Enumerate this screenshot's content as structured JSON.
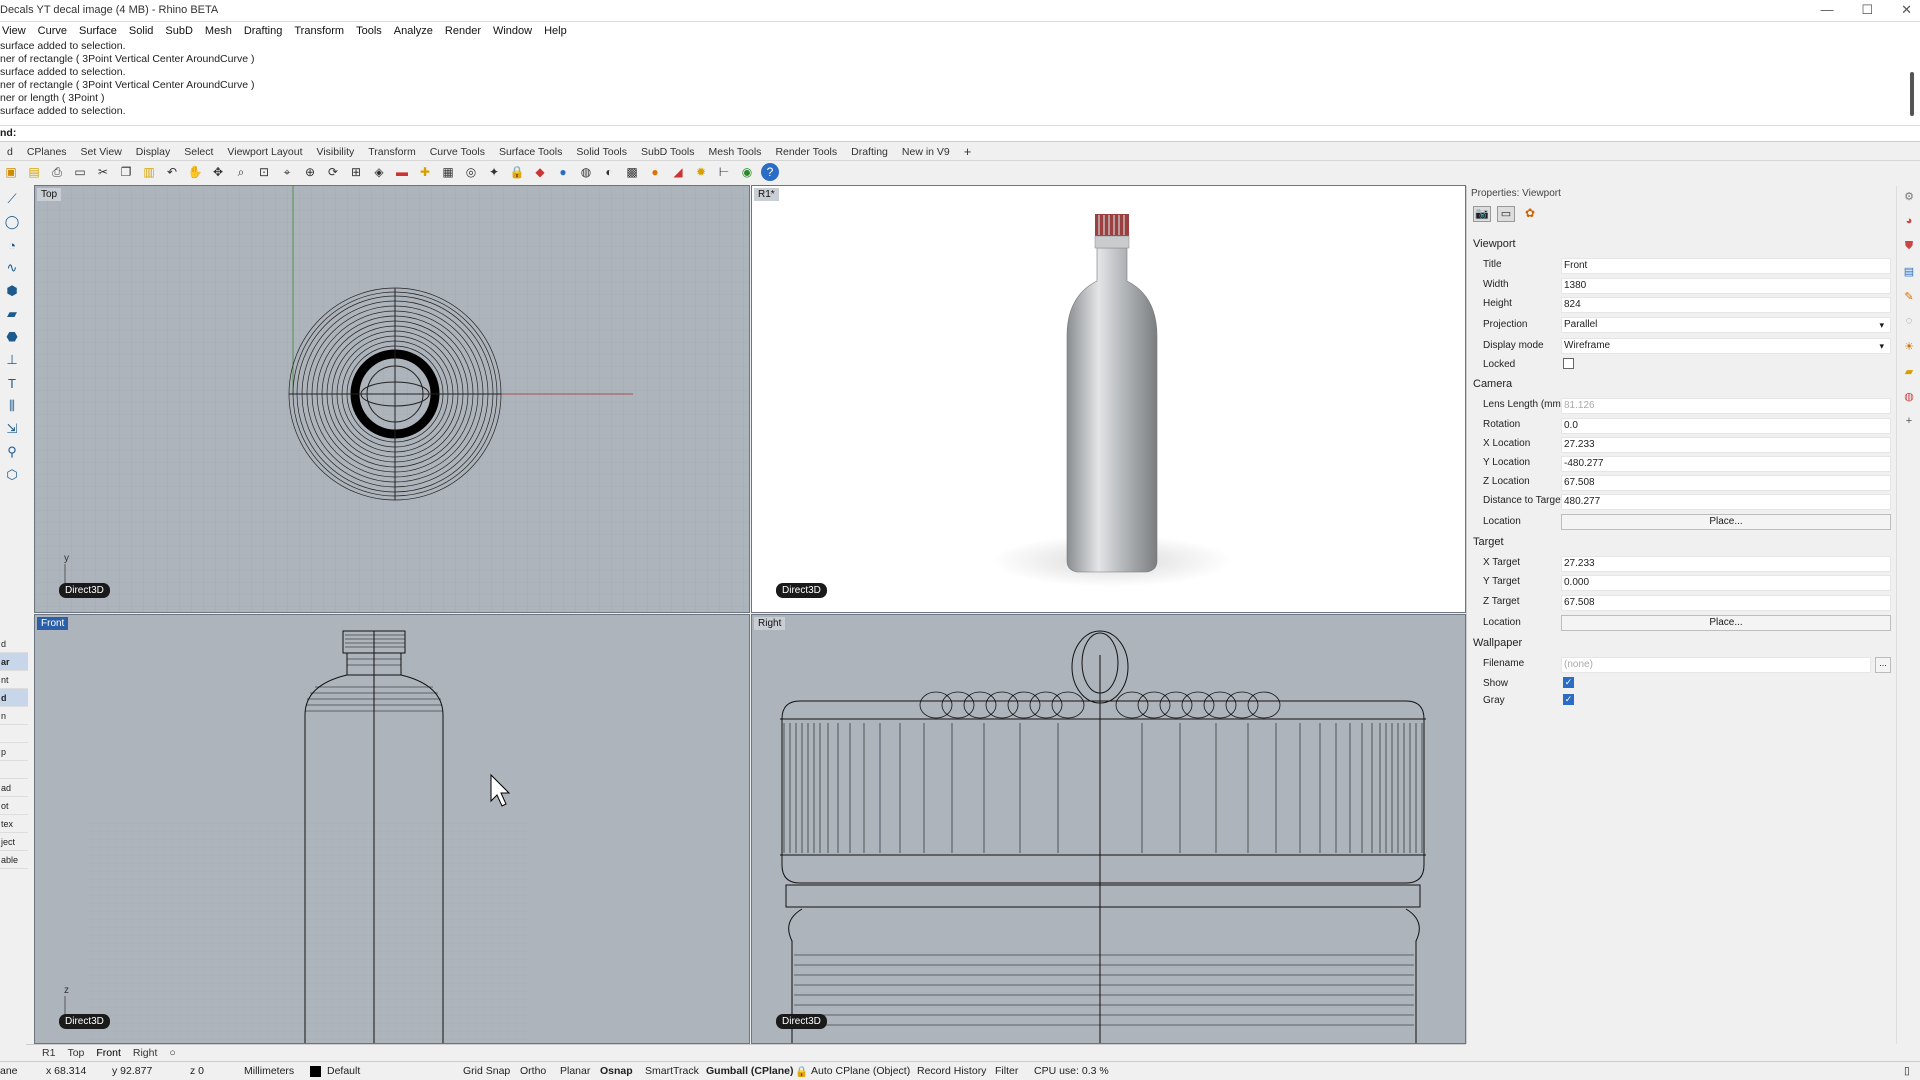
{
  "window": {
    "title": "Decals YT decal image (4 MB) - Rhino BETA",
    "controls": [
      "—",
      "☐",
      "✕"
    ]
  },
  "menu": [
    "View",
    "Curve",
    "Surface",
    "Solid",
    "SubD",
    "Mesh",
    "Drafting",
    "Transform",
    "Tools",
    "Analyze",
    "Render",
    "Window",
    "Help"
  ],
  "command_history": [
    "surface added to selection.",
    "ner of rectangle ( 3Point  Vertical  Center  AroundCurve )",
    "surface added to selection.",
    "ner of rectangle ( 3Point  Vertical  Center  AroundCurve )",
    "ner or length ( 3Point )",
    "surface added to selection."
  ],
  "command_prompt": "nd:",
  "toolbar_tabs": [
    "d",
    "CPlanes",
    "Set View",
    "Display",
    "Select",
    "Viewport Layout",
    "Visibility",
    "Transform",
    "Curve Tools",
    "Surface Tools",
    "Solid Tools",
    "SubD Tools",
    "Mesh Tools",
    "Render Tools",
    "Drafting",
    "New in V9"
  ],
  "toolbar_plus": "+",
  "viewports": {
    "top": {
      "title": "Top",
      "badge": "Direct3D",
      "axis": "y"
    },
    "perspective": {
      "title": "R1*",
      "badge": "Direct3D"
    },
    "front": {
      "title": "Front",
      "badge": "Direct3D",
      "axis": "z"
    },
    "right": {
      "title": "Right",
      "badge": "Direct3D"
    }
  },
  "left_panel_rows": [
    "d",
    "ar",
    "nt",
    "d",
    "n",
    "",
    "p",
    "",
    "ad",
    "ot",
    "tex",
    "ject",
    "able"
  ],
  "properties": {
    "header": "Properties: Viewport",
    "viewport_section": "Viewport",
    "title_label": "Title",
    "title_value": "Front",
    "width_label": "Width",
    "width_value": "1380",
    "height_label": "Height",
    "height_value": "824",
    "projection_label": "Projection",
    "projection_value": "Parallel",
    "display_label": "Display mode",
    "display_value": "Wireframe",
    "locked_label": "Locked",
    "camera_section": "Camera",
    "lens_label": "Lens Length (mm)",
    "lens_value": "81.126",
    "rotation_label": "Rotation",
    "rotation_value": "0.0",
    "xloc_label": "X Location",
    "xloc_value": "27.233",
    "yloc_label": "Y Location",
    "yloc_value": "-480.277",
    "zloc_label": "Z Location",
    "zloc_value": "67.508",
    "dist_label": "Distance to Target",
    "dist_value": "480.277",
    "location_label": "Location",
    "place_label": "Place...",
    "target_section": "Target",
    "xt_label": "X Target",
    "xt_value": "27.233",
    "yt_label": "Y Target",
    "yt_value": "0.000",
    "zt_label": "Z Target",
    "zt_value": "67.508",
    "tlocation_label": "Location",
    "tplace_label": "Place...",
    "wallpaper_section": "Wallpaper",
    "filename_label": "Filename",
    "filename_value": "(none)",
    "browse_label": "...",
    "show_label": "Show",
    "gray_label": "Gray"
  },
  "viewport_tabs": [
    "R1",
    "Top",
    "Front",
    "Right"
  ],
  "viewport_tab_add": "○",
  "status": {
    "plane": "ane",
    "x": "x 68.314",
    "y": "y 92.877",
    "z": "z 0",
    "units": "Millimeters",
    "layer": "Default",
    "grid_snap": "Grid Snap",
    "ortho": "Ortho",
    "planar": "Planar",
    "osnap": "Osnap",
    "smarttrack": "SmartTrack",
    "gumball": "Gumball (CPlane)",
    "autocplane": "Auto CPlane (Object)",
    "record": "Record History",
    "filter": "Filter",
    "cpu": "CPU use: 0.3 %"
  },
  "colors": {
    "viewport_bg": "#aeb4bc",
    "active_title": "#2b5fa8",
    "checkbox": "#2b6cc4"
  }
}
